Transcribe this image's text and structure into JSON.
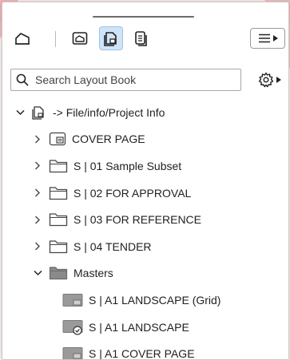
{
  "toolbar": {
    "tools": [
      {
        "name": "project-map-icon",
        "active": false
      },
      {
        "name": "view-map-icon",
        "active": false
      },
      {
        "name": "layout-book-icon",
        "active": true
      },
      {
        "name": "publisher-sets-icon",
        "active": false
      }
    ]
  },
  "search": {
    "placeholder": "Search Layout Book"
  },
  "tree": {
    "root": {
      "label": "-> File/info/Project Info"
    },
    "items": [
      {
        "label": "COVER PAGE"
      },
      {
        "label": "S | 01 Sample Subset"
      },
      {
        "label": "S | 02 FOR APPROVAL"
      },
      {
        "label": "S | 03 FOR REFERENCE"
      },
      {
        "label": "S | 04 TENDER"
      },
      {
        "label": "Masters"
      }
    ],
    "masters": [
      {
        "label": "S | A1 LANDSCAPE (Grid)"
      },
      {
        "label": "S | A1 LANDSCAPE"
      },
      {
        "label": "S | A1 COVER PAGE"
      }
    ]
  },
  "colors": {
    "active_tool_bg": "#cfe4f7",
    "folder_fill": "#ffffff",
    "masters_folder_fill": "#8a8a8a"
  }
}
